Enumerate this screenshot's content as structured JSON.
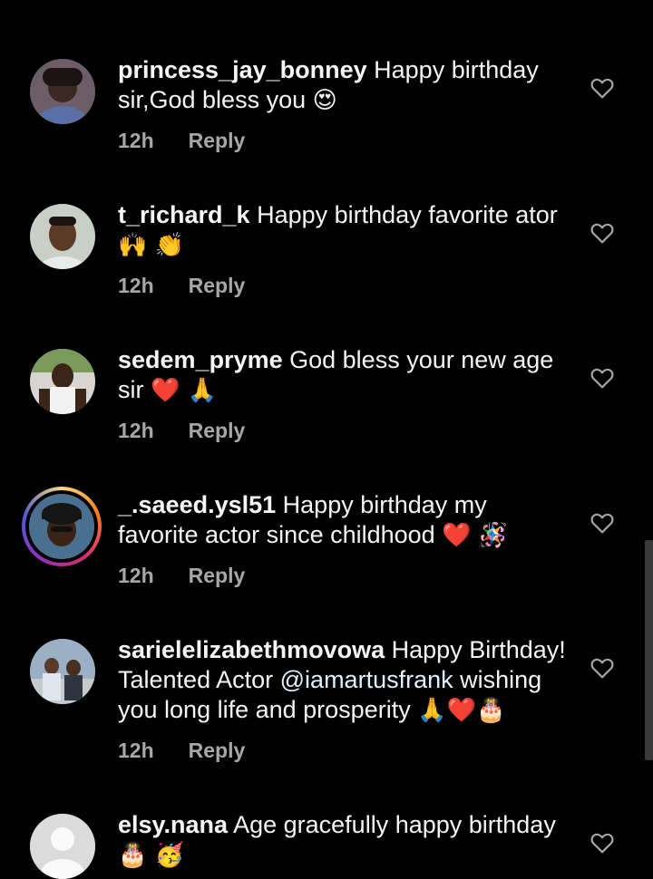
{
  "comments": [
    {
      "username": "princess_jay_bonney",
      "text": "Happy birthday sir,God bless you",
      "emoji": "😍",
      "time": "12h",
      "reply": "Reply",
      "avatar": "photo"
    },
    {
      "username": "t_richard_k",
      "text": "Happy birthday favorite ator",
      "emoji": "🙌 👏",
      "time": "12h",
      "reply": "Reply",
      "avatar": "photo"
    },
    {
      "username": "sedem_pryme",
      "text": "God bless your new age sir",
      "emoji": "❤️ 🙏",
      "time": "12h",
      "reply": "Reply",
      "avatar": "photo"
    },
    {
      "username": "_.saeed.ysl51",
      "text": "Happy birthday my favorite actor since childhood",
      "emoji": "❤️ 🪅",
      "time": "12h",
      "reply": "Reply",
      "avatar": "photo-story"
    },
    {
      "username": "sarielelizabethmovowa",
      "text_before": "Happy Birthday! Talented Actor",
      "mention": "@iamartusfrank",
      "text_after": "wishing you long life and prosperity",
      "emoji": "🙏❤️🎂",
      "time": "12h",
      "reply": "Reply",
      "avatar": "photo"
    },
    {
      "username": "elsy.nana",
      "text": "Age gracefully happy birthday",
      "emoji": "🎂 🥳",
      "avatar": "default"
    }
  ],
  "icons": {
    "like": "heart-outline-icon"
  },
  "colors": {
    "background": "#000000",
    "text": "#f5f5f5",
    "meta": "#a8a8a8"
  }
}
